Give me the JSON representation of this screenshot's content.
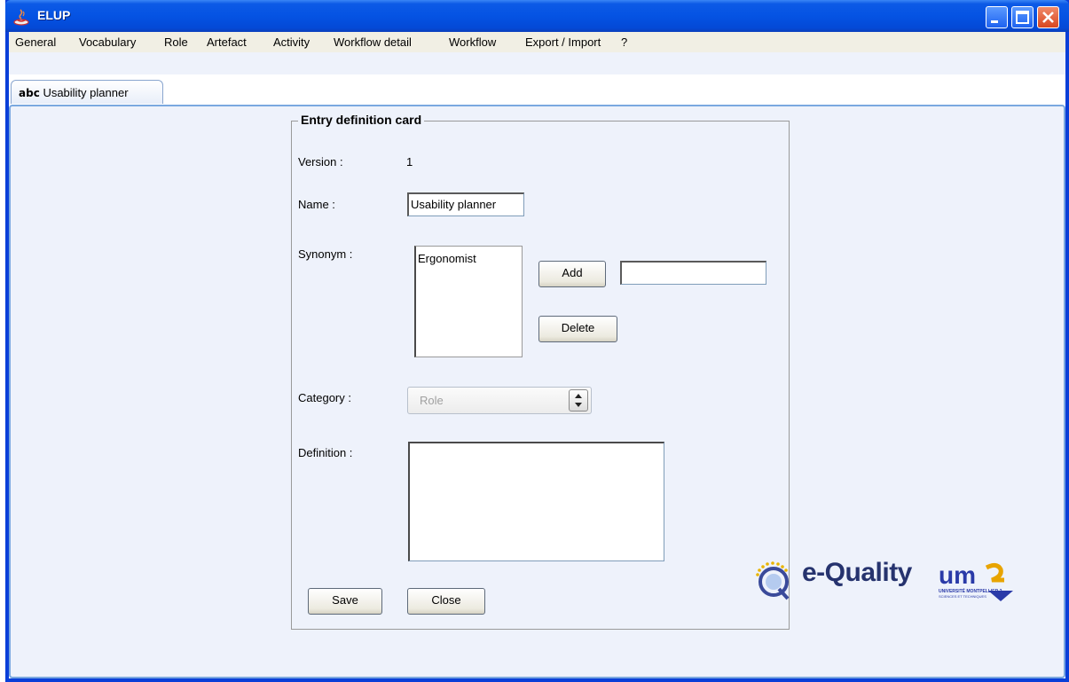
{
  "window": {
    "title": "ELUP",
    "icon": "java-icon"
  },
  "menubar": {
    "items": [
      "General",
      "Vocabulary",
      "Role",
      "Artefact",
      "Activity",
      "Workflow detail",
      "Workflow",
      "Export / Import",
      "?"
    ]
  },
  "tab": {
    "badge": "abc",
    "label": "Usability planner"
  },
  "card": {
    "title": "Entry definition card",
    "version_label": "Version :",
    "version_value": "1",
    "name_label": "Name :",
    "name_value": "Usability planner",
    "synonym_label": "Synonym :",
    "synonyms": [
      "Ergonomist"
    ],
    "synonym_input_value": "",
    "add_label": "Add",
    "delete_label": "Delete",
    "category_label": "Category :",
    "category_value": "Role",
    "definition_label": "Definition :",
    "definition_value": "",
    "save_label": "Save",
    "close_label": "Close"
  },
  "logos": {
    "equality_text": "e-Quality",
    "university_text": "UNIVERSITÉ MONTPELLIER 2"
  },
  "colors": {
    "titlebar": "#0553e3",
    "content_bg": "#eef2fb",
    "menubar_bg": "#f1efe4",
    "equality_text": "#26336e"
  }
}
